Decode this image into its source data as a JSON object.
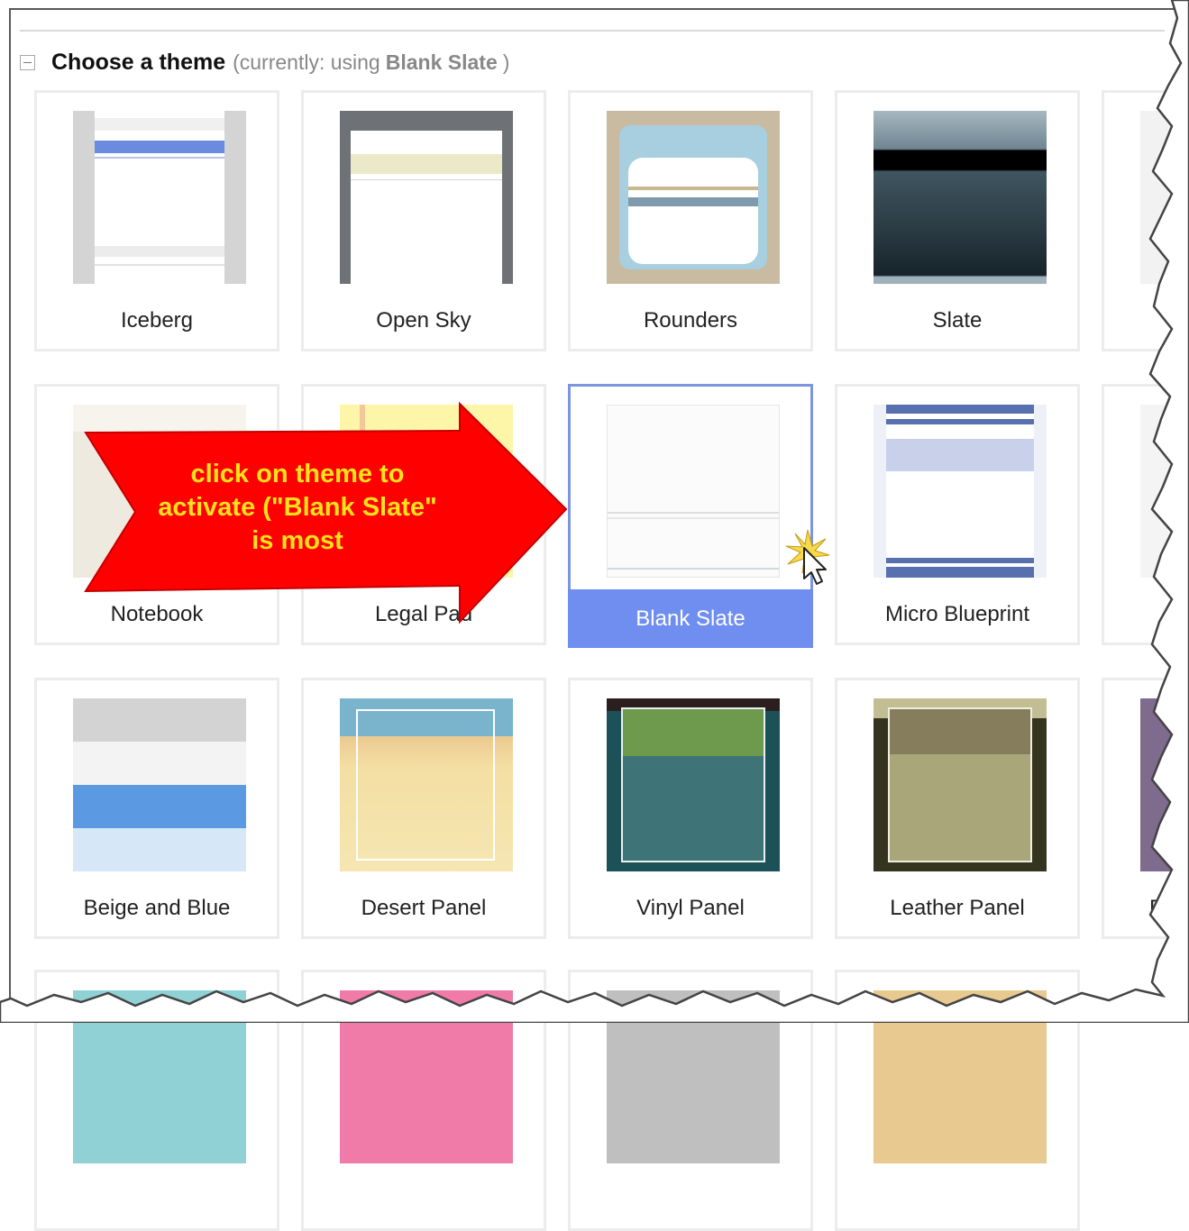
{
  "section": {
    "title": "Choose a theme",
    "currently_prefix": "(currently: using",
    "current_theme": "Blank Slate",
    "currently_suffix": ")"
  },
  "themes": [
    {
      "label": "Iceberg"
    },
    {
      "label": "Open Sky"
    },
    {
      "label": "Rounders"
    },
    {
      "label": "Slate"
    },
    {
      "label": "Notebook"
    },
    {
      "label": "Legal Pad"
    },
    {
      "label": "Blank Slate",
      "selected": true
    },
    {
      "label": "Micro Blueprint"
    },
    {
      "label": "Beige and Blue"
    },
    {
      "label": "Desert Panel"
    },
    {
      "label": "Vinyl Panel"
    },
    {
      "label": "Leather Panel"
    }
  ],
  "partial_label": "E",
  "annotation": {
    "text": "click on theme to activate (\"Blank Slate\" is most",
    "arrow_color": "#ff0000",
    "text_color": "#ffe21a"
  },
  "colors": {
    "selected_border": "#7b95de",
    "selected_label_bg": "#6f8ef0"
  }
}
